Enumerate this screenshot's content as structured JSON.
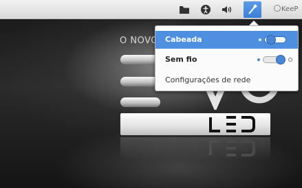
{
  "panel": {
    "user_label": "KeeP",
    "icons": [
      "folder-icon",
      "accessibility-icon",
      "volume-icon",
      "network-icon"
    ]
  },
  "wallpaper": {
    "slogan": "O NOVO"
  },
  "network_menu": {
    "items": [
      {
        "label": "Cabeada",
        "toggle": "on",
        "highlighted": true
      },
      {
        "label": "Sem fio",
        "toggle": "on",
        "highlighted": false
      },
      {
        "label": "Configurações de rede"
      }
    ]
  },
  "colors": {
    "accent": "#4f8fe0",
    "panel_bg": "#e6e6e6",
    "menu_bg": "#fbfbfb"
  }
}
